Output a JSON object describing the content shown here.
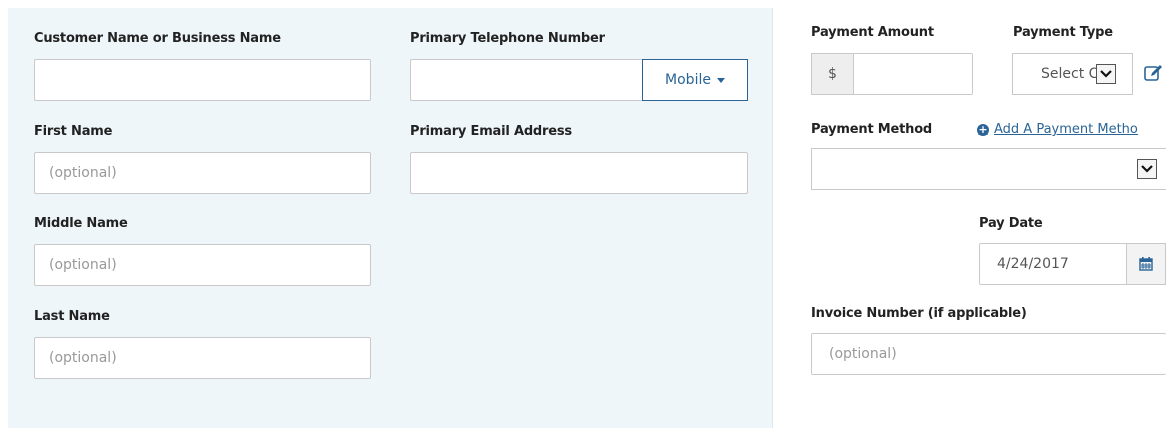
{
  "customer": {
    "business_name_label": "Customer Name or Business Name",
    "business_name_value": "",
    "phone_label": "Primary Telephone Number",
    "phone_value": "",
    "phone_type": "Mobile",
    "first_name_label": "First Name",
    "first_name_placeholder": "(optional)",
    "email_label": "Primary Email Address",
    "email_value": "",
    "middle_name_label": "Middle Name",
    "middle_name_placeholder": "(optional)",
    "last_name_label": "Last Name",
    "last_name_placeholder": "(optional)"
  },
  "payment": {
    "amount_label": "Payment Amount",
    "currency_symbol": "$",
    "amount_value": "",
    "type_label": "Payment Type",
    "type_selected": "Select C",
    "method_label": "Payment Method",
    "add_method_link": "Add A Payment Metho",
    "method_selected": "",
    "pay_date_label": "Pay Date",
    "pay_date_value": "4/24/2017",
    "invoice_label": "Invoice Number (if applicable)",
    "invoice_placeholder": "(optional)"
  },
  "colors": {
    "panel_bg": "#eef6fa",
    "accent": "#2a6496"
  },
  "icons": {
    "phone_type_dropdown": "caret-down-icon",
    "edit": "edit-icon",
    "add": "plus-circle-icon",
    "calendar": "calendar-icon",
    "select": "chevron-down-icon"
  }
}
